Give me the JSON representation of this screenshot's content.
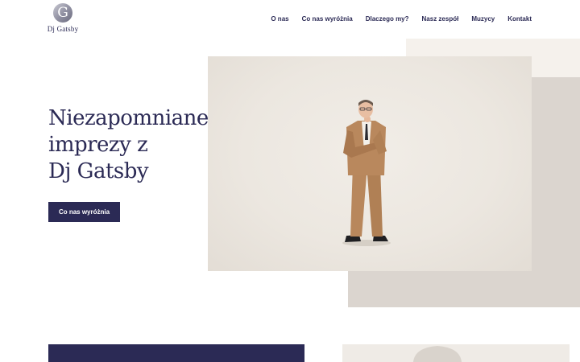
{
  "brand": {
    "logo_glyph": "G",
    "logo_text": "Dj Gatsby"
  },
  "nav": {
    "items": [
      {
        "label": "O nas"
      },
      {
        "label": "Co nas wyróżnia"
      },
      {
        "label": "Dlaczego my?"
      },
      {
        "label": "Nasz zespół"
      },
      {
        "label": "Muzycy"
      },
      {
        "label": "Kontakt"
      }
    ]
  },
  "hero": {
    "title_lines": [
      "Niezapomniane",
      "imprezy z",
      "Dj Gatsby"
    ],
    "cta_label": "Co nas wyróżnia"
  },
  "colors": {
    "primary": "#2b2a55",
    "beige_light": "#f5f1ec",
    "beige_dark": "#dbd5cf",
    "suit": "#b8875c"
  }
}
